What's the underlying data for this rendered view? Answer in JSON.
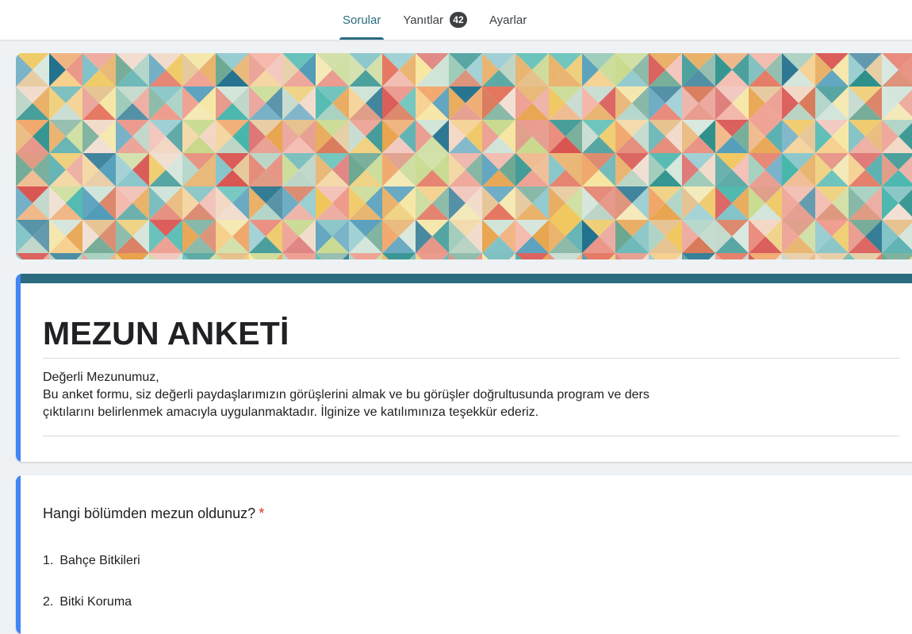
{
  "tabs": [
    {
      "label": "Sorular",
      "active": true
    },
    {
      "label": "Yanıtlar",
      "badge": "42"
    },
    {
      "label": "Ayarlar"
    }
  ],
  "colors": {
    "accent": "#2a6b7f",
    "left_bar": "#4285f4",
    "required": "#d93025"
  },
  "form": {
    "title": "MEZUN ANKETİ",
    "description_lines": [
      "Değerli Mezunumuz,",
      "Bu anket formu, siz değerli paydaşlarımızın görüşlerini almak ve bu görüşler doğrultusunda program ve ders",
      "çıktılarını belirlenmek amacıyla uygulanmaktadır. İlginize ve katılımınıza teşekkür ederiz."
    ]
  },
  "question": {
    "text": "Hangi bölümden mezun oldunuz?",
    "required_mark": "*",
    "options": [
      {
        "num": "1.",
        "label": "Bahçe Bitkileri"
      },
      {
        "num": "2.",
        "label": "Bitki Koruma"
      }
    ]
  }
}
